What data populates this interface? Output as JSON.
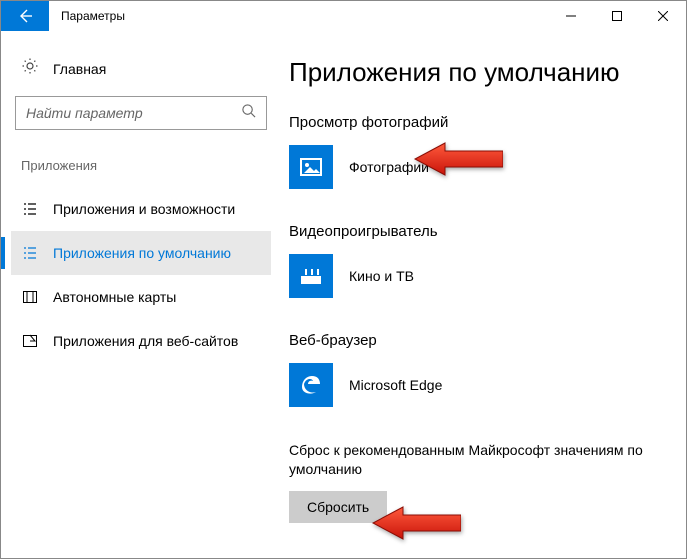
{
  "window": {
    "title": "Параметры"
  },
  "sidebar": {
    "home": "Главная",
    "search_placeholder": "Найти параметр",
    "section": "Приложения",
    "items": [
      {
        "label": "Приложения и возможности"
      },
      {
        "label": "Приложения по умолчанию"
      },
      {
        "label": "Автономные карты"
      },
      {
        "label": "Приложения для веб-сайтов"
      }
    ]
  },
  "content": {
    "title": "Приложения по умолчанию",
    "groups": [
      {
        "label": "Просмотр фотографий",
        "app": "Фотографии",
        "icon": "photos"
      },
      {
        "label": "Видеопроигрыватель",
        "app": "Кино и ТВ",
        "icon": "movies"
      },
      {
        "label": "Веб-браузер",
        "app": "Microsoft Edge",
        "icon": "edge"
      }
    ],
    "reset_text": "Сброс к рекомендованным Майкрософт значениям по умолчанию",
    "reset_button": "Сбросить"
  }
}
